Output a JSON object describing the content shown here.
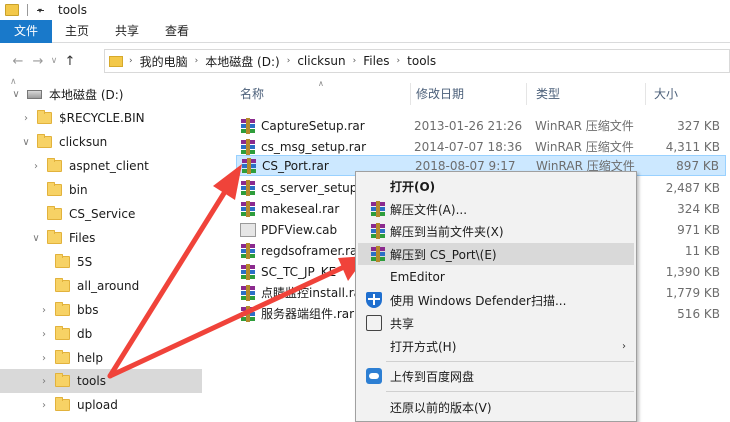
{
  "window": {
    "title": "tools"
  },
  "ribbon": {
    "tabs": [
      "文件",
      "主页",
      "共享",
      "查看"
    ]
  },
  "address": {
    "crumbs": [
      "我的电脑",
      "本地磁盘 (D:)",
      "clicksun",
      "Files",
      "tools"
    ]
  },
  "tree": {
    "items": [
      {
        "label": "本地磁盘 (D:)",
        "type": "drive",
        "expanded": true
      },
      {
        "label": "$RECYCLE.BIN",
        "type": "folder",
        "expandable": true
      },
      {
        "label": "clicksun",
        "type": "folder",
        "expanded": true
      },
      {
        "label": "aspnet_client",
        "type": "folder",
        "expandable": true
      },
      {
        "label": "bin",
        "type": "folder"
      },
      {
        "label": "CS_Service",
        "type": "folder"
      },
      {
        "label": "Files",
        "type": "folder",
        "expanded": true
      },
      {
        "label": "5S",
        "type": "folder"
      },
      {
        "label": "all_around",
        "type": "folder"
      },
      {
        "label": "bbs",
        "type": "folder",
        "expandable": true
      },
      {
        "label": "db",
        "type": "folder",
        "expandable": true
      },
      {
        "label": "help",
        "type": "folder",
        "expandable": true
      },
      {
        "label": "tools",
        "type": "folder",
        "expandable": true,
        "selected": true
      },
      {
        "label": "upload",
        "type": "folder",
        "expandable": true
      }
    ]
  },
  "filelist": {
    "columns": {
      "name": "名称",
      "date": "修改日期",
      "type": "类型",
      "size": "大小"
    },
    "files": [
      {
        "name": "CaptureSetup.rar",
        "date": "2013-01-26 21:26",
        "type": "WinRAR 压缩文件",
        "size": "327 KB",
        "icon": "winrar-icon"
      },
      {
        "name": "cs_msg_setup.rar",
        "date": "2014-07-07 18:36",
        "type": "WinRAR 压缩文件",
        "size": "4,311 KB",
        "icon": "winrar-icon"
      },
      {
        "name": "CS_Port.rar",
        "date": "2018-08-07 9:17",
        "type": "WinRAR 压缩文件",
        "size": "897 KB",
        "icon": "winrar-icon",
        "selected": true
      },
      {
        "name": "cs_server_setup.",
        "date": "",
        "type": "",
        "size": "2,487 KB",
        "icon": "winrar-icon"
      },
      {
        "name": "makeseal.rar",
        "date": "",
        "type": "",
        "size": "324 KB",
        "icon": "winrar-icon"
      },
      {
        "name": "PDFView.cab",
        "date": "",
        "type": "",
        "size": "971 KB",
        "icon": "cab-icon"
      },
      {
        "name": "regdsoframer.ra",
        "date": "",
        "type": "",
        "size": "11 KB",
        "icon": "winrar-icon"
      },
      {
        "name": "SC_TC_JP_KE",
        "date": "",
        "type": "",
        "size": "1,390 KB",
        "icon": "winrar-icon"
      },
      {
        "name": "点睛监控install.ra",
        "date": "",
        "type": "",
        "size": "1,779 KB",
        "icon": "winrar-icon"
      },
      {
        "name": "服务器端组件.rar",
        "date": "",
        "type": "",
        "size": "516 KB",
        "icon": "winrar-icon"
      }
    ]
  },
  "contextmenu": {
    "items": [
      {
        "label": "打开(O)",
        "bold": true
      },
      {
        "label": "解压文件(A)...",
        "icon": "winrar-icon"
      },
      {
        "label": "解压到当前文件夹(X)",
        "icon": "winrar-icon"
      },
      {
        "label": "解压到 CS_Port\\(E)",
        "icon": "winrar-icon",
        "highlighted": true
      },
      {
        "label": "EmEditor"
      },
      {
        "label": "使用 Windows Defender扫描...",
        "icon": "shield-icon"
      },
      {
        "label": "共享",
        "icon": "share-icon"
      },
      {
        "label": "打开方式(H)",
        "submenu": true
      },
      {
        "label": "上传到百度网盘",
        "icon": "cloud-icon"
      },
      {
        "label": "还原以前的版本(V)"
      }
    ]
  },
  "colors": {
    "file_tab": "#1979ca",
    "selection": "#cce8ff",
    "arrow": "#f0433a"
  }
}
